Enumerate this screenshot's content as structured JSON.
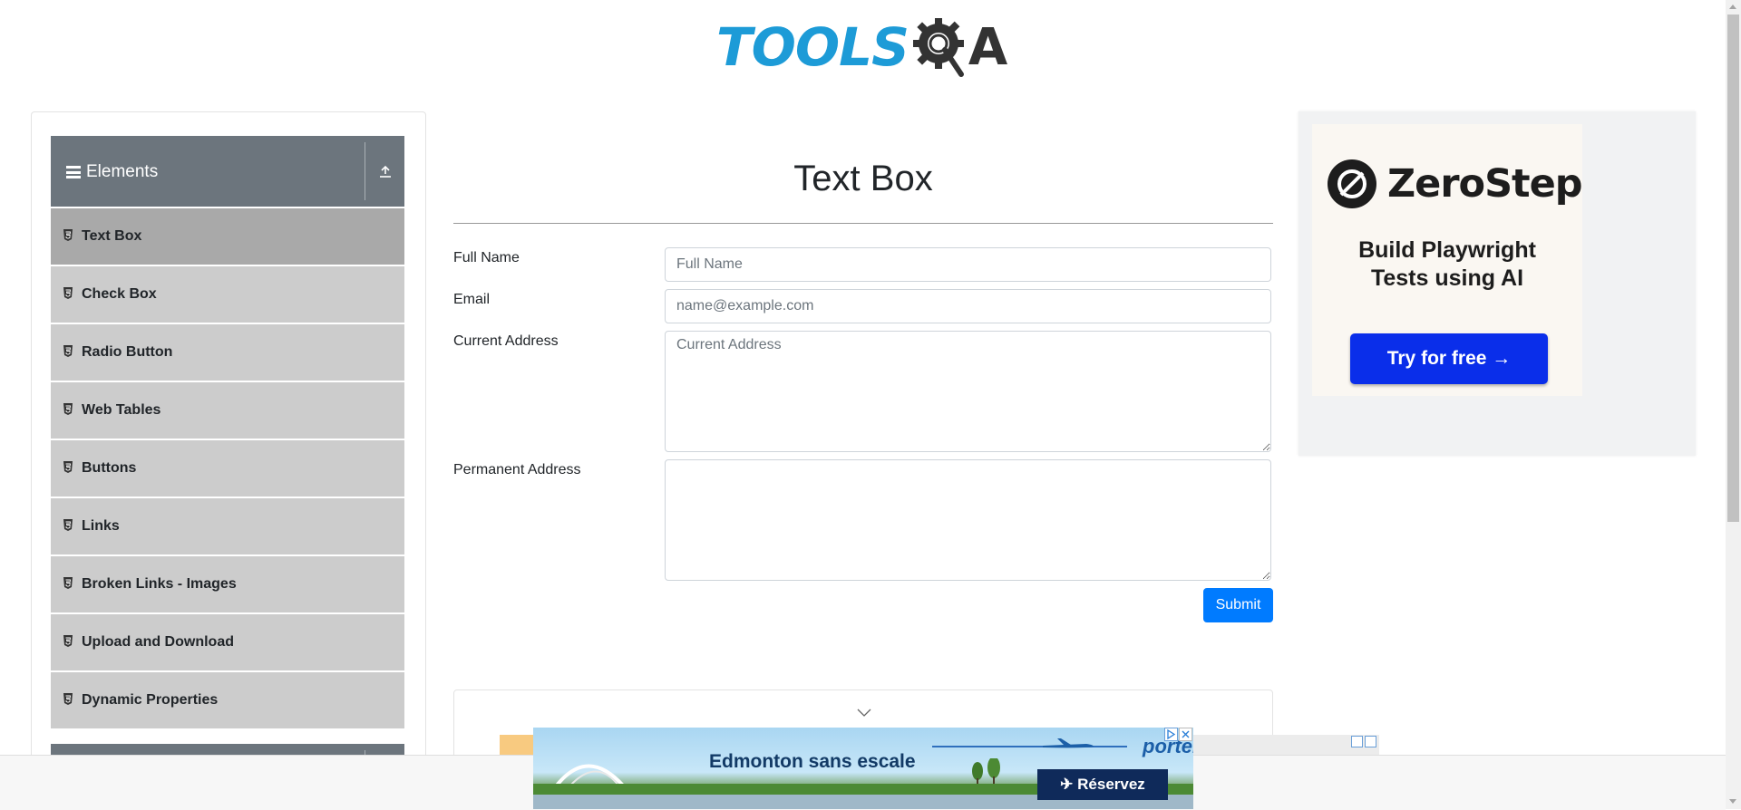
{
  "header": {
    "logo_text": "TOOLS",
    "logo_suffix": "A"
  },
  "sidebar": {
    "group_title": "Elements",
    "items": [
      {
        "label": "Text Box",
        "active": true
      },
      {
        "label": "Check Box"
      },
      {
        "label": "Radio Button"
      },
      {
        "label": "Web Tables"
      },
      {
        "label": "Buttons"
      },
      {
        "label": "Links"
      },
      {
        "label": "Broken Links - Images"
      },
      {
        "label": "Upload and Download"
      },
      {
        "label": "Dynamic Properties"
      }
    ]
  },
  "main": {
    "title": "Text Box",
    "full_name": {
      "label": "Full Name",
      "placeholder": "Full Name",
      "value": ""
    },
    "email": {
      "label": "Email",
      "placeholder": "name@example.com",
      "value": ""
    },
    "current_address": {
      "label": "Current Address",
      "placeholder": "Current Address",
      "value": ""
    },
    "permanent_address": {
      "label": "Permanent Address",
      "placeholder": "",
      "value": ""
    },
    "submit_label": "Submit"
  },
  "ad_right": {
    "brand": "ZeroStep",
    "tagline_line1": "Build Playwright",
    "tagline_line2": "Tests using AI",
    "cta": "Try for free →"
  },
  "ad_bottom": {
    "brand": "porter",
    "headline": "Edmonton sans escale",
    "cta": "Réservez"
  },
  "colors": {
    "accent": "#007bff",
    "sidebar_header": "#6c757d",
    "sidebar_item": "#cccccc",
    "sidebar_item_active": "#a9a9a9",
    "logo_blue": "#1d9bd7",
    "ad_cta": "#0a2eea"
  }
}
